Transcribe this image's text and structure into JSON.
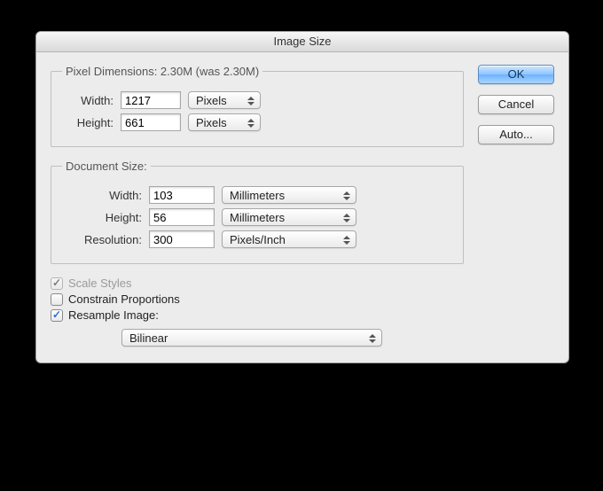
{
  "title": "Image Size",
  "buttons": {
    "ok": "OK",
    "cancel": "Cancel",
    "auto": "Auto..."
  },
  "pixelDimensions": {
    "legend": "Pixel Dimensions:  2.30M (was 2.30M)",
    "widthLabel": "Width:",
    "widthValue": "1217",
    "widthUnit": "Pixels",
    "heightLabel": "Height:",
    "heightValue": "661",
    "heightUnit": "Pixels"
  },
  "documentSize": {
    "legend": "Document Size:",
    "widthLabel": "Width:",
    "widthValue": "103",
    "widthUnit": "Millimeters",
    "heightLabel": "Height:",
    "heightValue": "56",
    "heightUnit": "Millimeters",
    "resolutionLabel": "Resolution:",
    "resolutionValue": "300",
    "resolutionUnit": "Pixels/Inch"
  },
  "options": {
    "scaleStyles": "Scale Styles",
    "constrainProportions": "Constrain Proportions",
    "resampleImage": "Resample Image:"
  },
  "resampleMethod": "Bilinear"
}
